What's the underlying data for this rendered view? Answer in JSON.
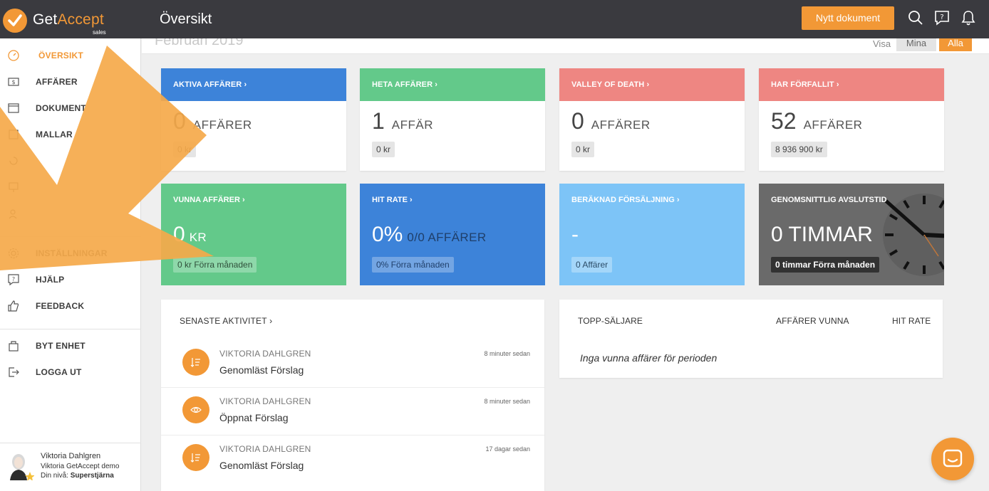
{
  "app": {
    "logo_get": "Get",
    "logo_accept": "Accept",
    "logo_sub": "sales",
    "page_title": "Översikt",
    "new_doc_label": "Nytt dokument"
  },
  "sidebar": {
    "items": [
      {
        "label": "ÖVERSIKT"
      },
      {
        "label": "AFFÄRER"
      },
      {
        "label": "DOKUMENT"
      },
      {
        "label": "MALLAR"
      },
      {
        "label": "INSTÄLLNINGAR"
      },
      {
        "label": "HJÄLP"
      },
      {
        "label": "FEEDBACK"
      },
      {
        "label": "BYT ENHET"
      },
      {
        "label": "LOGGA UT"
      }
    ],
    "user": {
      "name": "Viktoria Dahlgren",
      "company": "Viktoria GetAccept demo",
      "level_label": "Din nivå:",
      "level_value": "Superstjärna"
    }
  },
  "subheader": {
    "period": "Februari 2019",
    "visa": "Visa",
    "mina": "Mina",
    "alla": "Alla"
  },
  "cards": [
    {
      "title": "AKTIVA AFFÄRER ›",
      "number": "0",
      "unit": "AFFÄRER",
      "chip": "0 kr",
      "color": "#3d83d9"
    },
    {
      "title": "HETA AFFÄRER ›",
      "number": "1",
      "unit": "AFFÄR",
      "chip": "0 kr",
      "color": "#63c98a"
    },
    {
      "title": "VALLEY OF DEATH ›",
      "number": "0",
      "unit": "AFFÄRER",
      "chip": "0 kr",
      "color": "#ee8682"
    },
    {
      "title": "HAR FÖRFALLIT ›",
      "number": "52",
      "unit": "AFFÄRER",
      "chip": "8 936 900 kr",
      "color": "#ee8682"
    }
  ],
  "tiles": [
    {
      "title": "VUNNA AFFÄRER ›",
      "number": "0",
      "unit": "KR",
      "chip": "0 kr Förra månaden",
      "color": "#63c98a"
    },
    {
      "title": "HIT RATE ›",
      "number": "0%",
      "unit": "0/0 AFFÄRER",
      "chip": "0% Förra månaden",
      "color": "#3d83d9"
    },
    {
      "title": "BERÄKNAD FÖRSÄLJNING ›",
      "number": "-",
      "unit": "",
      "chip": "0 Affärer",
      "color": "#7dc4f7"
    },
    {
      "title": "GENOMSNITTLIG AVSLUTSTID",
      "number": "0 TIMMAR",
      "unit": "",
      "chip": "0 timmar Förra månaden",
      "color": "#6a6a6a"
    }
  ],
  "activity": {
    "title": "SENASTE AKTIVITET ›",
    "rows": [
      {
        "name": "VIKTORIA DAHLGREN",
        "desc": "Genomläst Förslag",
        "time": "8 minuter sedan",
        "icon": "list-sort-icon"
      },
      {
        "name": "VIKTORIA DAHLGREN",
        "desc": "Öppnat Förslag",
        "time": "8 minuter sedan",
        "icon": "eye-icon"
      },
      {
        "name": "VIKTORIA DAHLGREN",
        "desc": "Genomläst Förslag",
        "time": "17 dagar sedan",
        "icon": "list-sort-icon"
      }
    ]
  },
  "sellers": {
    "col1": "TOPP-SÄLJARE",
    "col2": "AFFÄRER VUNNA",
    "col3": "HIT RATE",
    "empty": "Inga vunna affärer för perioden"
  }
}
